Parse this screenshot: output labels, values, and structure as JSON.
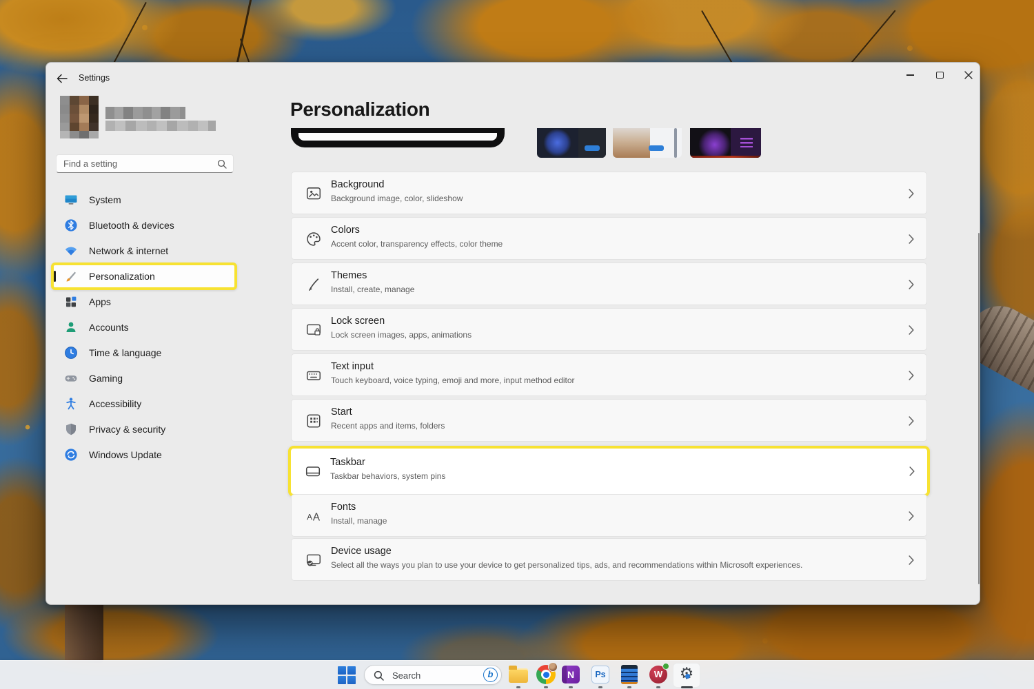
{
  "window": {
    "title": "Settings"
  },
  "sidebar": {
    "search": {
      "placeholder": "Find a setting"
    },
    "items": [
      {
        "label": "System",
        "icon": "system-icon"
      },
      {
        "label": "Bluetooth & devices",
        "icon": "bluetooth-icon"
      },
      {
        "label": "Network & internet",
        "icon": "network-icon"
      },
      {
        "label": "Personalization",
        "icon": "personalization-icon",
        "selected": true,
        "highlighted": true
      },
      {
        "label": "Apps",
        "icon": "apps-icon"
      },
      {
        "label": "Accounts",
        "icon": "accounts-icon"
      },
      {
        "label": "Time & language",
        "icon": "time-language-icon"
      },
      {
        "label": "Gaming",
        "icon": "gaming-icon"
      },
      {
        "label": "Accessibility",
        "icon": "accessibility-icon"
      },
      {
        "label": "Privacy & security",
        "icon": "privacy-security-icon"
      },
      {
        "label": "Windows Update",
        "icon": "windows-update-icon"
      }
    ]
  },
  "main": {
    "title": "Personalization",
    "cards": [
      {
        "title": "Background",
        "subtitle": "Background image, color, slideshow",
        "icon": "background-icon"
      },
      {
        "title": "Colors",
        "subtitle": "Accent color, transparency effects, color theme",
        "icon": "colors-icon"
      },
      {
        "title": "Themes",
        "subtitle": "Install, create, manage",
        "icon": "themes-icon"
      },
      {
        "title": "Lock screen",
        "subtitle": "Lock screen images, apps, animations",
        "icon": "lock-screen-icon"
      },
      {
        "title": "Text input",
        "subtitle": "Touch keyboard, voice typing, emoji and more, input method editor",
        "icon": "text-input-icon"
      },
      {
        "title": "Start",
        "subtitle": "Recent apps and items, folders",
        "icon": "start-icon"
      },
      {
        "title": "Taskbar",
        "subtitle": "Taskbar behaviors, system pins",
        "icon": "taskbar-icon",
        "highlighted": true
      },
      {
        "title": "Fonts",
        "subtitle": "Install, manage",
        "icon": "fonts-icon"
      },
      {
        "title": "Device usage",
        "subtitle": "Select all the ways you plan to use your device to get personalized tips, ads, and recommendations within Microsoft experiences.",
        "icon": "device-usage-icon"
      }
    ]
  },
  "taskbar": {
    "search_placeholder": "Search",
    "apps": [
      "start",
      "search",
      "file-explorer",
      "chrome",
      "onenote",
      "photoshop",
      "notes",
      "wps-office",
      "settings"
    ]
  },
  "colors": {
    "highlight_yellow": "#f7e232",
    "accent_blue": "#2d7dd2"
  }
}
